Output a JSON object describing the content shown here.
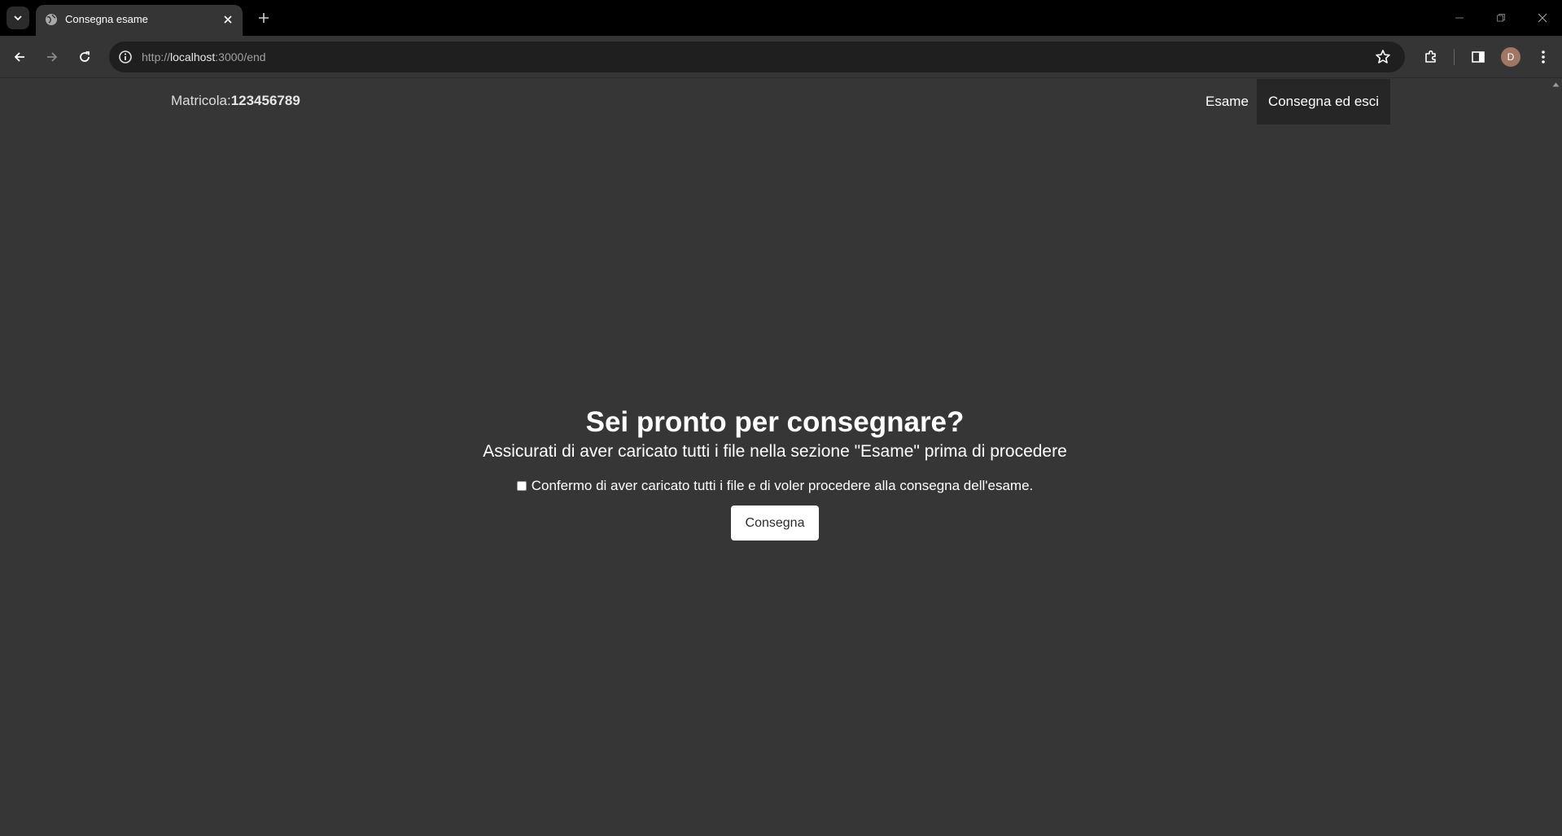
{
  "browser": {
    "tab_title": "Consegna esame",
    "url_scheme": "http://",
    "url_host": "localhost",
    "url_path": ":3000/end",
    "profile_initial": "D"
  },
  "navbar": {
    "matricola_label": "Matricola:",
    "matricola_value": "123456789",
    "links": [
      {
        "label": "Esame"
      },
      {
        "label": "Consegna ed esci"
      }
    ]
  },
  "main": {
    "heading": "Sei pronto per consegnare?",
    "subheading": "Assicurati di aver caricato tutti i file nella sezione \"Esame\" prima di procedere",
    "confirm_label": "Confermo di aver caricato tutti i file e di voler procedere alla consegna dell'esame.",
    "confirm_checked": false,
    "submit_label": "Consegna"
  },
  "colors": {
    "page_background": "#363636",
    "navbar_active_background": "#262626",
    "button_background": "#ffffff"
  }
}
